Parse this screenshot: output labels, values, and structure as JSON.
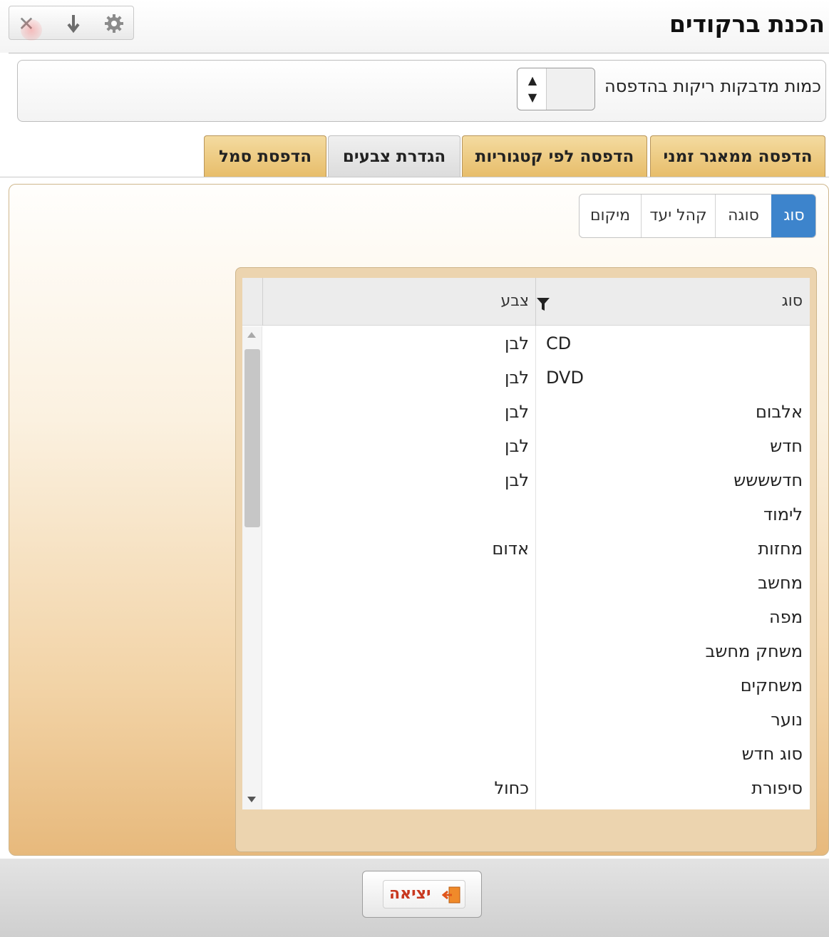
{
  "window": {
    "title": "הכנת ברקודים",
    "toolbar": {
      "close_icon": "close-icon",
      "download_icon": "arrow-down-icon",
      "settings_icon": "gear-icon"
    }
  },
  "quantity": {
    "label": "כמות מדבקות ריקות בהדפסה",
    "value": ""
  },
  "main_tabs": [
    {
      "label": "הדפסה ממאגר זמני",
      "active": false
    },
    {
      "label": "הדפסה לפי קטגוריות",
      "active": false
    },
    {
      "label": "הגדרת צבעים",
      "active": true
    },
    {
      "label": "הדפסת סמל",
      "active": false
    }
  ],
  "sub_tabs": [
    {
      "label": "סוג",
      "active": true
    },
    {
      "label": "סוגה",
      "active": false
    },
    {
      "label": "קהל יעד",
      "active": false
    },
    {
      "label": "מיקום",
      "active": false
    }
  ],
  "grid": {
    "headers": {
      "type": "סוג",
      "color": "צבע"
    },
    "rows": [
      {
        "type": "CD",
        "color": "לבן"
      },
      {
        "type": "DVD",
        "color": "לבן"
      },
      {
        "type": "אלבום",
        "color": "לבן"
      },
      {
        "type": "חדש",
        "color": "לבן"
      },
      {
        "type": "חדשששש",
        "color": "לבן"
      },
      {
        "type": "לימוד",
        "color": ""
      },
      {
        "type": "מחזות",
        "color": "אדום"
      },
      {
        "type": "מחשב",
        "color": ""
      },
      {
        "type": "מפה",
        "color": ""
      },
      {
        "type": "משחק מחשב",
        "color": ""
      },
      {
        "type": "משחקים",
        "color": ""
      },
      {
        "type": "נוער",
        "color": ""
      },
      {
        "type": "סוג חדש",
        "color": ""
      },
      {
        "type": "סיפורת",
        "color": "כחול"
      }
    ]
  },
  "footer": {
    "exit_label": "יציאה"
  },
  "colors": {
    "active_subtab": "#3d84cc",
    "tab_gold": "#e7bd6a",
    "exit_text": "#c8381f"
  }
}
